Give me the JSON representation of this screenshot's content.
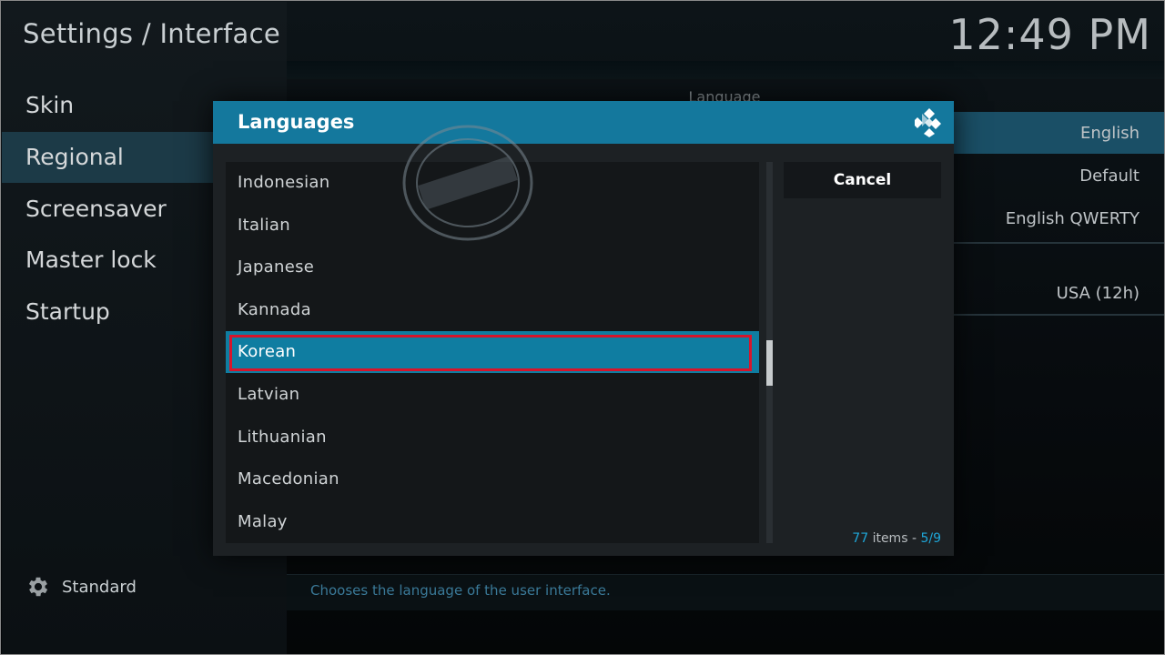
{
  "page_title": "Settings / Interface",
  "clock": "12:49 PM",
  "sidebar": {
    "items": [
      {
        "label": "Skin",
        "active": false
      },
      {
        "label": "Regional",
        "active": true
      },
      {
        "label": "Screensaver",
        "active": false
      },
      {
        "label": "Master lock",
        "active": false
      },
      {
        "label": "Startup",
        "active": false
      }
    ],
    "settings_level": "Standard"
  },
  "settings": {
    "group_label": "Language",
    "rows": [
      "English",
      "Default",
      "English QWERTY",
      "USA (12h)"
    ],
    "description": "Chooses the language of the user interface."
  },
  "dialog": {
    "title": "Languages",
    "items": [
      "Indonesian",
      "Italian",
      "Japanese",
      "Kannada",
      "Korean",
      "Latvian",
      "Lithuanian",
      "Macedonian",
      "Malay"
    ],
    "focused_item": "Korean",
    "cancel_label": "Cancel",
    "count_total": "77",
    "count_word": "items",
    "count_sep": "-",
    "page": "5/9"
  },
  "colors": {
    "accent": "#14789d",
    "focus_outline": "#d6152b",
    "active_nav": "#1c3a47"
  },
  "icons": [
    "gear-icon",
    "kodi-logo-icon"
  ]
}
